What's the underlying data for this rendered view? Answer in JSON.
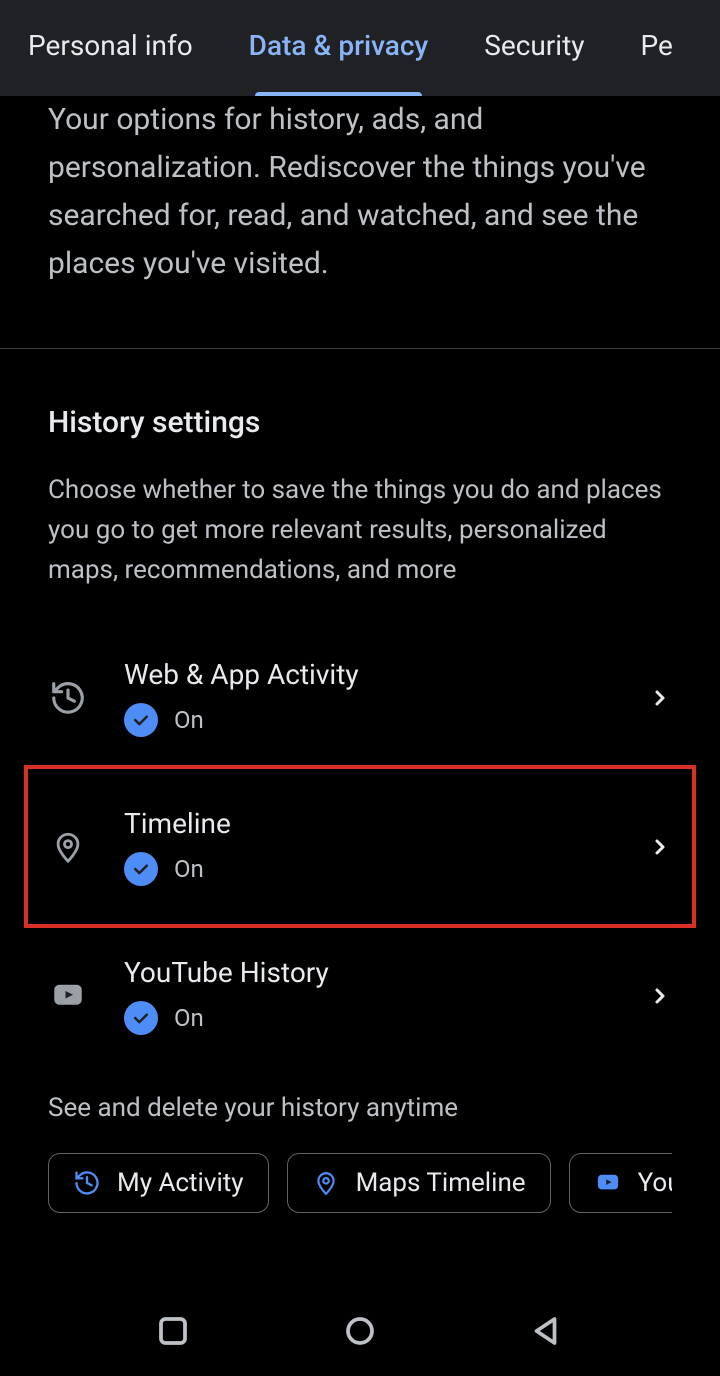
{
  "tabs": {
    "personal": "Personal info",
    "data": "Data & privacy",
    "security": "Security",
    "people": "Pe"
  },
  "intro": "Your options for history, ads, and personalization. Rediscover the things you've searched for, read, and watched, and see the places you've visited.",
  "history": {
    "heading": "History settings",
    "desc": "Choose whether to save the things you do and places you go to get more relevant results, personalized maps, recommendations, and more",
    "items": [
      {
        "title": "Web & App Activity",
        "status": "On"
      },
      {
        "title": "Timeline",
        "status": "On"
      },
      {
        "title": "YouTube History",
        "status": "On"
      }
    ],
    "subtext": "See and delete your history anytime",
    "chips": {
      "activity": "My Activity",
      "maps": "Maps Timeline",
      "youtube": "You"
    }
  }
}
